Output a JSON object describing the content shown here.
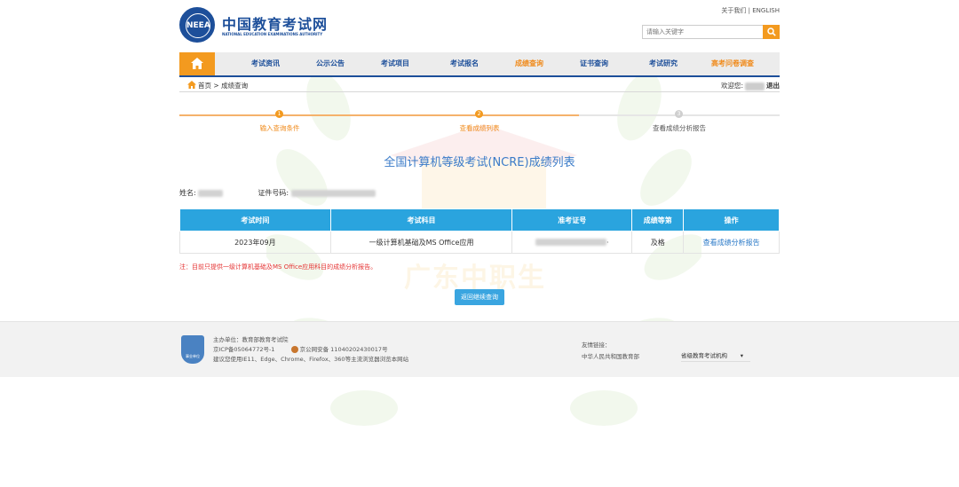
{
  "header": {
    "logo_badge": "NEEA",
    "site_name_cn": "中国教育考试网",
    "site_name_en": "NATIONAL EDUCATION EXAMINATIONS AUTHORITY",
    "top_links": [
      "关于我们",
      "ENGLISH"
    ],
    "search_placeholder": "请输入关键字"
  },
  "nav": {
    "items": [
      "考试资讯",
      "公示公告",
      "考试项目",
      "考试报名",
      "成绩查询",
      "证书查询",
      "考试研究",
      "高考问卷调查"
    ],
    "active": "成绩查询",
    "accent": "#f08a1a",
    "primary": "#1d4f9a"
  },
  "breadcrumb": {
    "home": "首页",
    "separator": ">",
    "current": "成绩查询",
    "welcome": "欢迎您:",
    "logout": "退出"
  },
  "steps": [
    "输入查询条件",
    "查看成绩列表",
    "查看成绩分析报告"
  ],
  "step_numbers": [
    "1",
    "2",
    "3"
  ],
  "page_title": "全国计算机等级考试(NCRE)成绩列表",
  "candidate": {
    "name_label": "姓名:",
    "id_label": "证件号码:"
  },
  "table": {
    "headers": [
      "考试时间",
      "考试科目",
      "准考证号",
      "成绩等第",
      "操作"
    ],
    "rows": [
      {
        "date": "2023年09月",
        "subject": "一级计算机基础及MS Office应用",
        "ticket_suffix": "·",
        "grade": "及格",
        "action": "查看成绩分析报告"
      }
    ]
  },
  "note": "注：目前只提供一级计算机基础及MS Office应用科目的成绩分析报告。",
  "back_button": "返回继续查询",
  "footer": {
    "badge_text": "事业单位",
    "host": "主办单位：教育部教育考试院",
    "icp": "京ICP备05064772号-1",
    "police": "京公网安备 11040202430017号",
    "browser_tip": "建议您使用IE11、Edge、Chrome、Firefox、360等主流浏览器浏览本网站",
    "friend_links_label": "友情链接：",
    "friend_link": "中华人民共和国教育部",
    "select_label": "省级教育考试机构",
    "select_arrow": "▾"
  },
  "watermark": "广东中职生"
}
